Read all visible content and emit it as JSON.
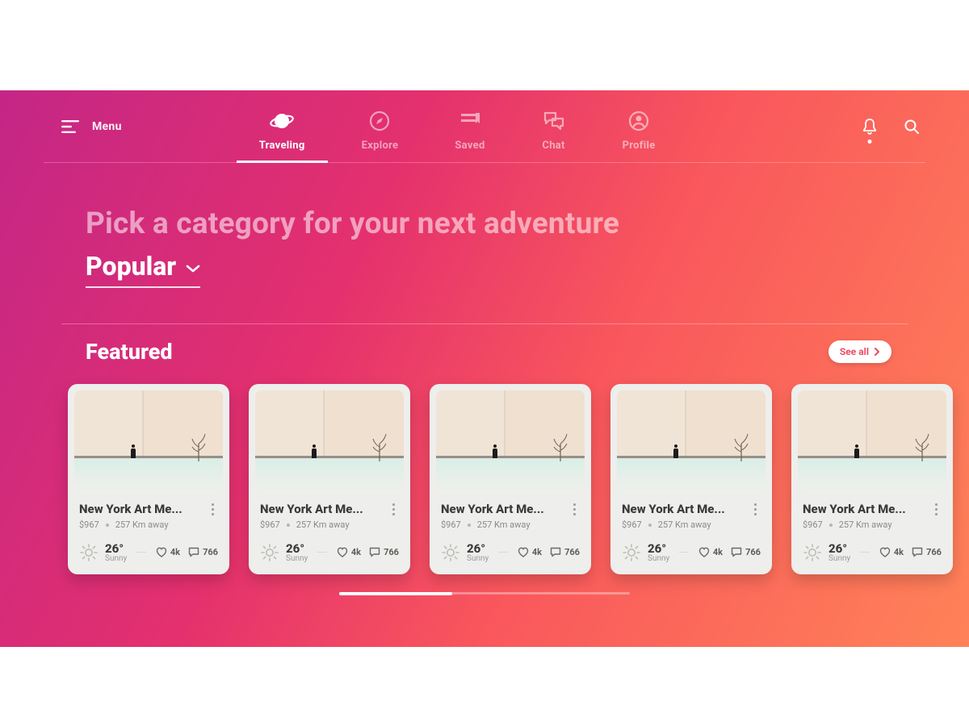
{
  "header": {
    "menu_label": "Menu",
    "tabs": [
      {
        "label": "Traveling",
        "active": true,
        "icon": "planet"
      },
      {
        "label": "Explore",
        "active": false,
        "icon": "compass"
      },
      {
        "label": "Saved",
        "active": false,
        "icon": "bookmark"
      },
      {
        "label": "Chat",
        "active": false,
        "icon": "chat"
      },
      {
        "label": "Profile",
        "active": false,
        "icon": "profile"
      }
    ],
    "has_notification": true
  },
  "hero": {
    "title": "Pick a category for your next adventure",
    "category": "Popular"
  },
  "featured": {
    "title": "Featured",
    "see_all_label": "See all",
    "card": {
      "title": "New York Art Me...",
      "price": "$967",
      "distance": "257 Km away",
      "temp": "26°",
      "condition": "Sunny",
      "likes": "4k",
      "comments": "766"
    }
  }
}
